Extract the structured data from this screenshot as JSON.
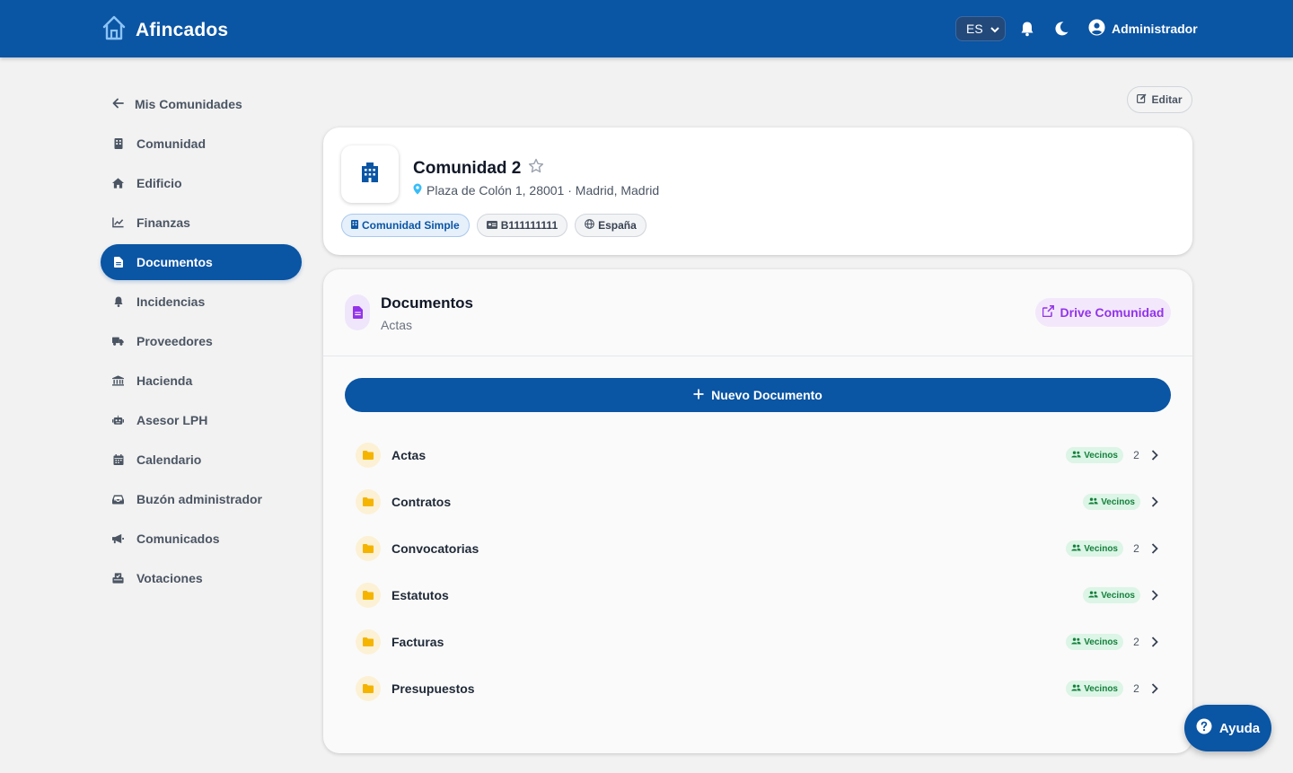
{
  "header": {
    "brand": "Afincados",
    "language": "ES",
    "user": "Administrador"
  },
  "sidebar": {
    "back": "Mis Comunidades",
    "items": [
      {
        "label": "Comunidad",
        "icon": "building-icon"
      },
      {
        "label": "Edificio",
        "icon": "home-icon"
      },
      {
        "label": "Finanzas",
        "icon": "chart-line-icon"
      },
      {
        "label": "Documentos",
        "icon": "file-icon",
        "active": true
      },
      {
        "label": "Incidencias",
        "icon": "bell-icon"
      },
      {
        "label": "Proveedores",
        "icon": "truck-icon"
      },
      {
        "label": "Hacienda",
        "icon": "bank-icon"
      },
      {
        "label": "Asesor LPH",
        "icon": "robot-icon"
      },
      {
        "label": "Calendario",
        "icon": "calendar-icon"
      },
      {
        "label": "Buzón administrador",
        "icon": "inbox-icon"
      },
      {
        "label": "Comunicados",
        "icon": "megaphone-icon"
      },
      {
        "label": "Votaciones",
        "icon": "ballot-box-icon"
      }
    ]
  },
  "edit_label": "Editar",
  "community": {
    "name": "Comunidad 2",
    "address": "Plaza de Colón 1, 28001 · Madrid, Madrid",
    "chips": {
      "type": "Comunidad Simple",
      "cif": "B111111111",
      "country": "España"
    }
  },
  "documents": {
    "title": "Documentos",
    "subtitle": "Actas",
    "drive_label": "Drive Comunidad",
    "new_label": "Nuevo Documento",
    "folders": [
      {
        "name": "Actas",
        "badge": "Vecinos",
        "count": "2"
      },
      {
        "name": "Contratos",
        "badge": "Vecinos",
        "count": ""
      },
      {
        "name": "Convocatorias",
        "badge": "Vecinos",
        "count": "2"
      },
      {
        "name": "Estatutos",
        "badge": "Vecinos",
        "count": ""
      },
      {
        "name": "Facturas",
        "badge": "Vecinos",
        "count": "2"
      },
      {
        "name": "Presupuestos",
        "badge": "Vecinos",
        "count": "2"
      }
    ]
  },
  "help_label": "Ayuda",
  "colors": {
    "primary": "#0a55a4",
    "purple": "#9333ea",
    "folder": "#f5b400",
    "badge_green": "#15803d"
  }
}
